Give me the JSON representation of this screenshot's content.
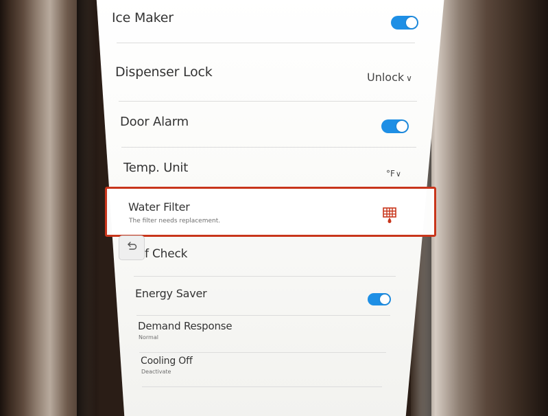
{
  "settings": {
    "ice_maker": {
      "label": "Ice Maker",
      "toggle_on": true
    },
    "dispenser_lock": {
      "label": "Dispenser Lock",
      "value": "Unlock"
    },
    "door_alarm": {
      "label": "Door Alarm",
      "toggle_on": true
    },
    "temp_unit": {
      "label": "Temp. Unit",
      "value": "°F"
    },
    "water_filter": {
      "label": "Water Filter",
      "subtitle": "The filter needs replacement."
    },
    "self_check": {
      "label": "f Check"
    },
    "energy_saver": {
      "label": "Energy Saver",
      "toggle_on": true
    },
    "demand_response": {
      "label": "Demand Response",
      "subtitle": "Normal"
    },
    "cooling_off": {
      "label": "Cooling Off",
      "subtitle": "Deactivate"
    }
  },
  "icons": {
    "filter_alert": "water-filter-alert-icon",
    "back": "back-icon",
    "dropdown": "chevron-down-icon"
  },
  "colors": {
    "toggle_on": "#1e8fe5",
    "alert_red": "#c8351b"
  }
}
